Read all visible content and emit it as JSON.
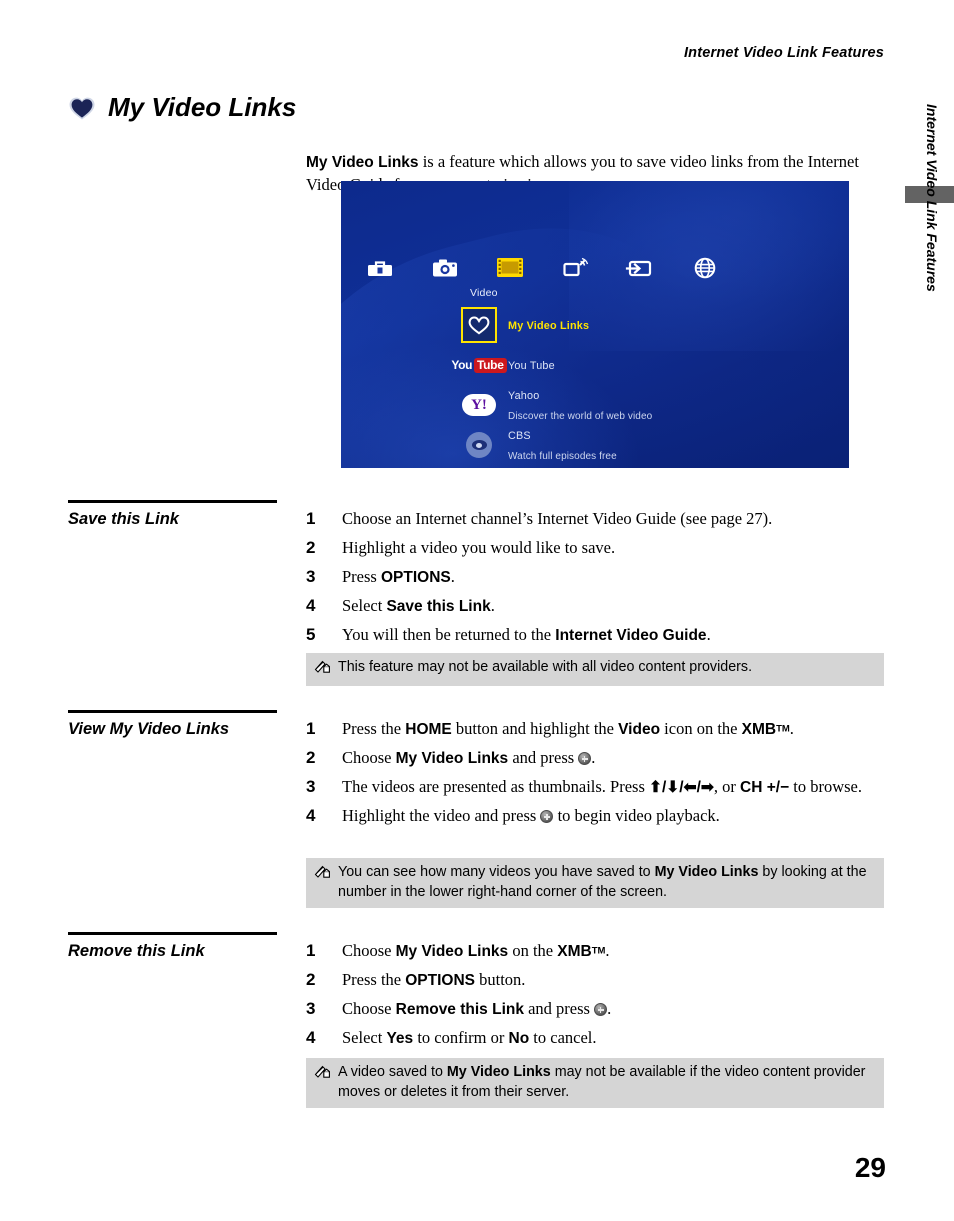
{
  "running_head": "Internet Video Link Features",
  "thumb_tab": {
    "label": "Internet Video Link Features",
    "bar_color": "#636363"
  },
  "heading": {
    "icon": "heart-icon",
    "title": "My Video Links"
  },
  "intro": {
    "bold_lead": "My Video Links",
    "rest": " is a feature which allows you to save video links from the Internet Video Guide for easy repeat viewing."
  },
  "tv_screenshot": {
    "alt": "XMB Video menu showing My Video Links selected",
    "background_color": "#0d2a8c",
    "highlight_color": "#ffe400",
    "category_label": "Video",
    "category_icons": [
      "toolbox-settings-icon",
      "camera-photo-icon",
      "film-video-icon",
      "music-network-icon",
      "input-source-icon",
      "globe-network-icon"
    ],
    "items": [
      {
        "icon": "heart-icon",
        "title": "My Video Links",
        "subtitle": "",
        "selected": true
      },
      {
        "icon": "youtube-logo",
        "title": "You Tube",
        "subtitle": "",
        "selected": false
      },
      {
        "icon": "yahoo-logo",
        "title": "Yahoo",
        "subtitle": "Discover the world of web video",
        "selected": false
      },
      {
        "icon": "cbs-eye-logo",
        "title": "CBS",
        "subtitle": "Watch full episodes free",
        "selected": false
      }
    ],
    "youtube_logo": {
      "part1": "You",
      "part2": "Tube",
      "badge_color": "#cc181e"
    },
    "yahoo_logo": {
      "text": "Y!"
    }
  },
  "sections": [
    {
      "title": "Save this Link",
      "steps": [
        {
          "num": "1",
          "html": "Choose an Internet channel’s Internet Video Guide (see page 27)."
        },
        {
          "num": "2",
          "html": "Highlight a video you would like to save."
        },
        {
          "num": "3",
          "html": "Press <b>OPTIONS</b>."
        },
        {
          "num": "4",
          "html": "Select <b>Save this Link</b>."
        },
        {
          "num": "5",
          "html": "You will then be returned to the <b>Internet Video Guide</b>."
        }
      ],
      "note": "This feature may not be available with all video content providers."
    },
    {
      "title": "View My Video Links",
      "steps": [
        {
          "num": "1",
          "html": "Press the <b>HOME</b> button and highlight the <b>Video</b> icon on the <b>XMB<span class=\"tm\">TM</span></b>."
        },
        {
          "num": "2",
          "html": "Choose <b>My Video Links</b> and press <span class=\"rnd-btn\"></span>."
        },
        {
          "num": "3",
          "html": "The videos are presented as thumbnails. Press <b>⬆/⬇/⬅/➡</b>, or <b>CH +/−</b> to browse."
        },
        {
          "num": "4",
          "html": "Highlight the video and press <span class=\"rnd-btn\"></span> to begin video playback."
        }
      ],
      "note": "You can see how many videos you have saved to <b>My Video Links</b> by looking at the number in the lower right-hand corner of the screen."
    },
    {
      "title": "Remove this Link",
      "steps": [
        {
          "num": "1",
          "html": "Choose <b>My Video Links</b> on the <b>XMB<span class=\"tm\">TM</span></b>."
        },
        {
          "num": "2",
          "html": "Press the <b>OPTIONS</b> button."
        },
        {
          "num": "3",
          "html": "Choose <b>Remove this Link</b> and press <span class=\"rnd-btn\"></span>."
        },
        {
          "num": "4",
          "html": "Select <b>Yes</b> to confirm or <b>No</b> to cancel."
        }
      ],
      "note": "A video saved to <b>My Video Links</b> may not be available if the video content provider moves or deletes it from their server."
    }
  ],
  "page_number": "29"
}
